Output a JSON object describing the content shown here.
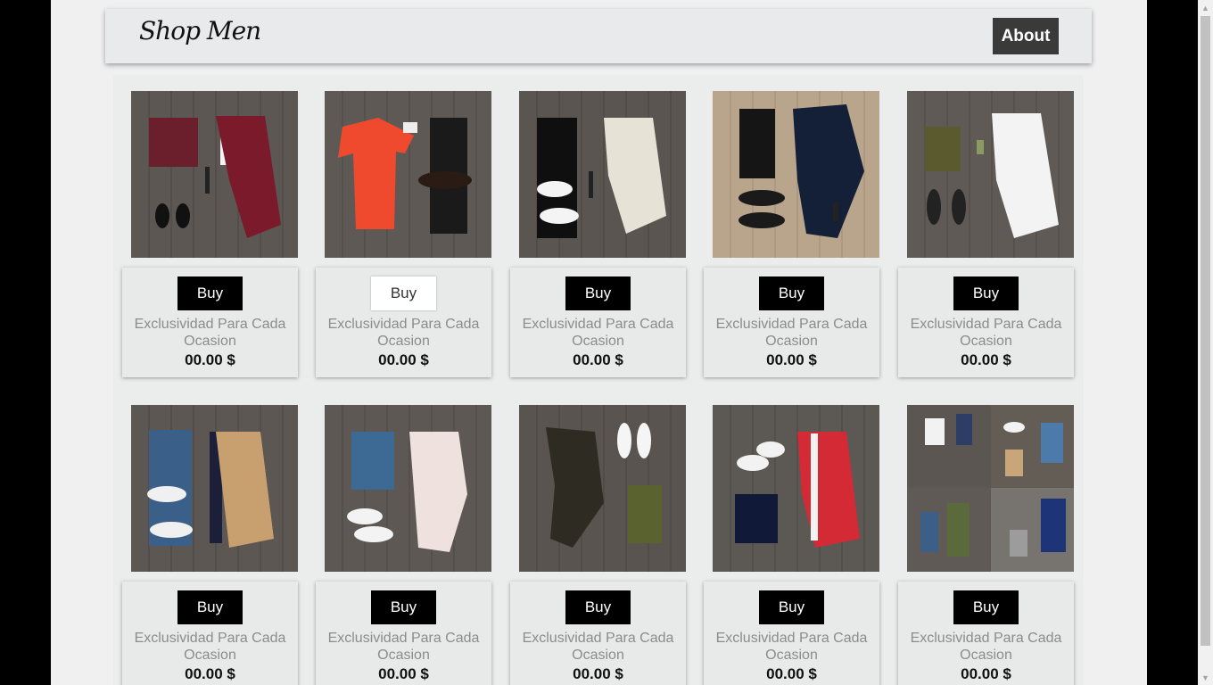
{
  "brand": {
    "logo": "Shop Men"
  },
  "nav": {
    "about_label": "About"
  },
  "products": [
    {
      "buy_label": "Buy",
      "description": "Exclusividad Para Cada Ocasion",
      "price": "00.00 $",
      "image": "burgundy-blazer-outfit"
    },
    {
      "buy_label": "Buy",
      "description": "Exclusividad Para Cada Ocasion",
      "price": "00.00 $",
      "image": "orange-tee-outfit"
    },
    {
      "buy_label": "Buy",
      "description": "Exclusividad Para Cada Ocasion",
      "price": "00.00 $",
      "image": "patterned-shirt-outfit"
    },
    {
      "buy_label": "Buy",
      "description": "Exclusividad Para Cada Ocasion",
      "price": "00.00 $",
      "image": "navy-dotted-shirt-outfit"
    },
    {
      "buy_label": "Buy",
      "description": "Exclusividad Para Cada Ocasion",
      "price": "00.00 $",
      "image": "white-shirt-outfit"
    },
    {
      "buy_label": "Buy",
      "description": "Exclusividad Para Cada Ocasion",
      "price": "00.00 $",
      "image": "tan-jacket-outfit"
    },
    {
      "buy_label": "Buy",
      "description": "Exclusividad Para Cada Ocasion",
      "price": "00.00 $",
      "image": "floral-shirt-outfit"
    },
    {
      "buy_label": "Buy",
      "description": "Exclusividad Para Cada Ocasion",
      "price": "00.00 $",
      "image": "leaf-print-shirt-outfit"
    },
    {
      "buy_label": "Buy",
      "description": "Exclusividad Para Cada Ocasion",
      "price": "00.00 $",
      "image": "red-track-jacket-outfit"
    },
    {
      "buy_label": "Buy",
      "description": "Exclusividad Para Cada Ocasion",
      "price": "00.00 $",
      "image": "outfit-collage"
    }
  ],
  "colors": {
    "page_bg": "#f0f0f1",
    "navbar_bg": "#e9eaeb",
    "about_bg": "#3a3a3a",
    "buy_bg": "#000000",
    "desc_text": "#8c8c8c"
  }
}
